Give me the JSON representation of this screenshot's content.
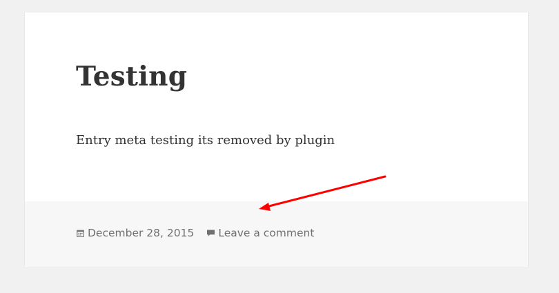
{
  "post": {
    "title": "Testing",
    "content": "Entry meta testing its removed by plugin"
  },
  "footer": {
    "date": "December 28, 2015",
    "comment_link": "Leave a comment"
  },
  "annotation": {
    "arrow_color": "#ff0000"
  },
  "colors": {
    "page_background": "#f1f1f1",
    "card_background": "#ffffff",
    "footer_background": "#f7f7f7",
    "title_text": "#333333",
    "meta_text": "#707070"
  },
  "icons": {
    "date": "calendar-icon",
    "comment": "comment-bubble-icon"
  }
}
